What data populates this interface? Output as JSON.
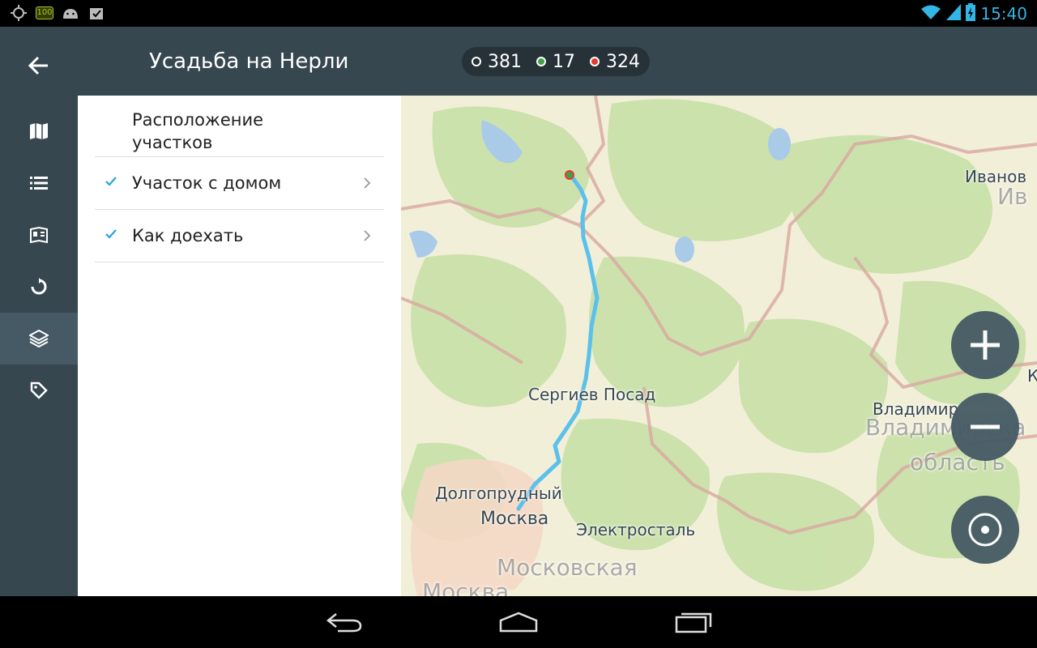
{
  "statusbar": {
    "battery_badge": "100",
    "time": "15:40",
    "icons": [
      "gps-icon",
      "battery-100-icon",
      "android-icon",
      "task-icon",
      "wifi-icon",
      "signal-icon",
      "battery-icon"
    ]
  },
  "header": {
    "title": "Усадьба на Нерли",
    "counters": [
      {
        "value": "381",
        "color": "#ffffff"
      },
      {
        "value": "17",
        "color": "#43a047"
      },
      {
        "value": "324",
        "color": "#e53935"
      }
    ]
  },
  "sidebar": {
    "items": [
      "map-icon",
      "list-icon",
      "brochure-icon",
      "refresh-icon",
      "layers-icon",
      "tag-icon"
    ],
    "active_index": 4
  },
  "panel": {
    "heading": "Расположение участков",
    "rows": [
      {
        "label": "Участок с домом",
        "checked": true
      },
      {
        "label": "Как доехать",
        "checked": true
      }
    ]
  },
  "map": {
    "labels": {
      "ivanovo": "Иванов",
      "ivanovo_region": "Ив",
      "sergiev": "Сергиев Посад",
      "vladimir": "Владимир",
      "vladimir_region": "Владимирска",
      "oblast": "область",
      "dolgoprudny": "Долгопрудный",
      "moscow": "Москва",
      "elektrostal": "Электросталь",
      "moscow_region": "Московская",
      "moscow2": "Москва",
      "k_letter": "К"
    },
    "route_color": "#5bc0eb"
  },
  "navbar": {
    "buttons": [
      "back-nav-icon",
      "home-nav-icon",
      "recents-nav-icon"
    ]
  }
}
